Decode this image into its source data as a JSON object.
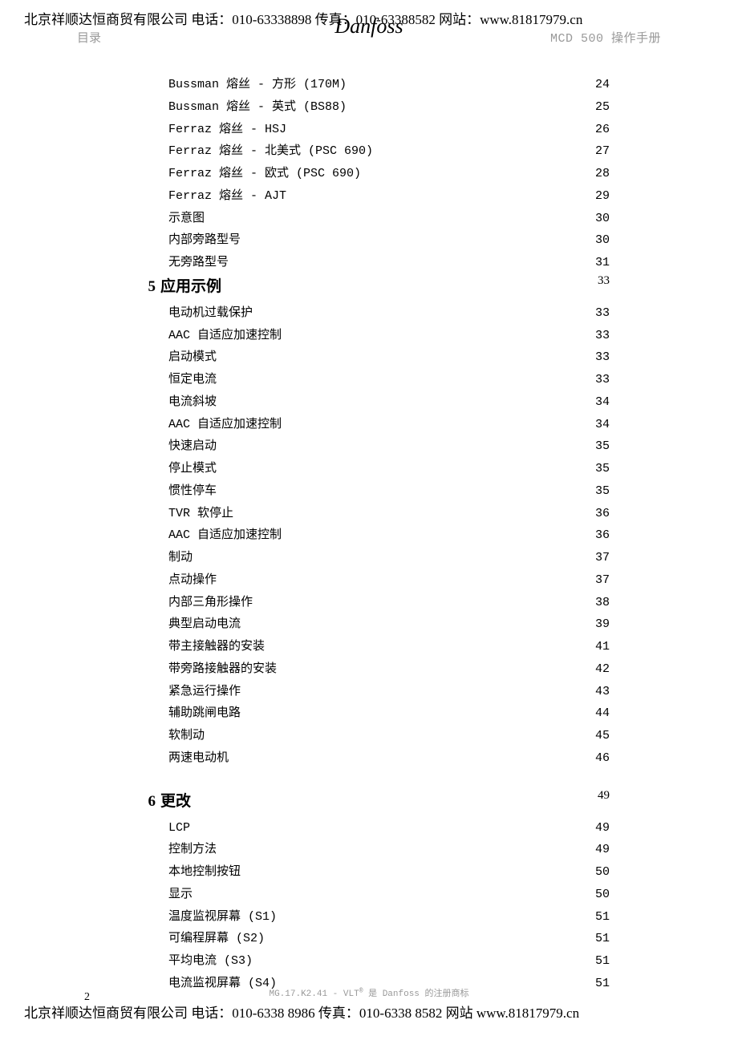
{
  "topHeader": "北京祥顺达恒商贸有限公司 电话：010-63338898 传真：010-63388582 网站：www.81817979.cn",
  "headerLeft": "目录",
  "logo": "Danfoss",
  "headerRight": "MCD 500 操作手册",
  "initialEntries": [
    {
      "title": "Bussman 熔丝 - 方形 (170M)",
      "page": "24"
    },
    {
      "title": "Bussman 熔丝 - 英式 (BS88)",
      "page": "25"
    },
    {
      "title": "Ferraz 熔丝 - HSJ",
      "page": "26"
    },
    {
      "title": "Ferraz 熔丝 - 北美式 (PSC 690)",
      "page": "27"
    },
    {
      "title": "Ferraz 熔丝 - 欧式 (PSC 690)",
      "page": "28"
    },
    {
      "title": "Ferraz 熔丝 - AJT",
      "page": "29"
    },
    {
      "title": "示意图",
      "page": "30"
    },
    {
      "title": "内部旁路型号",
      "page": "30"
    },
    {
      "title": "无旁路型号",
      "page": "31"
    }
  ],
  "sections": [
    {
      "num": "5",
      "title": "应用示例",
      "page": "33",
      "entries": [
        {
          "title": "电动机过载保护",
          "page": "33"
        },
        {
          "title": "AAC 自适应加速控制",
          "page": "33"
        },
        {
          "title": "启动模式",
          "page": "33"
        },
        {
          "title": "恒定电流",
          "page": "33"
        },
        {
          "title": "电流斜坡",
          "page": "34"
        },
        {
          "title": "AAC 自适应加速控制",
          "page": "34"
        },
        {
          "title": "快速启动",
          "page": "35"
        },
        {
          "title": "停止模式",
          "page": "35"
        },
        {
          "title": "惯性停车",
          "page": "35"
        },
        {
          "title": "TVR 软停止",
          "page": "36"
        },
        {
          "title": "AAC 自适应加速控制",
          "page": "36"
        },
        {
          "title": "制动",
          "page": "37"
        },
        {
          "title": "点动操作",
          "page": "37"
        },
        {
          "title": "内部三角形操作",
          "page": "38"
        },
        {
          "title": "典型启动电流",
          "page": "39"
        },
        {
          "title": "带主接触器的安装",
          "page": "41"
        },
        {
          "title": "带旁路接触器的安装",
          "page": "42"
        },
        {
          "title": "紧急运行操作",
          "page": "43"
        },
        {
          "title": "辅助跳闸电路",
          "page": "44"
        },
        {
          "title": "软制动",
          "page": "45"
        },
        {
          "title": "两速电动机",
          "page": "46"
        }
      ]
    },
    {
      "num": "6",
      "title": "更改",
      "page": "49",
      "entries": [
        {
          "title": "LCP",
          "page": "49"
        },
        {
          "title": "控制方法",
          "page": "49"
        },
        {
          "title": "本地控制按钮",
          "page": "50"
        },
        {
          "title": "显示",
          "page": "50"
        },
        {
          "title": "温度监视屏幕 (S1)",
          "page": "51"
        },
        {
          "title": "可编程屏幕 (S2)",
          "page": "51"
        },
        {
          "title": "平均电流 (S3)",
          "page": "51"
        },
        {
          "title": "电流监视屏幕 (S4)",
          "page": "51"
        }
      ]
    }
  ],
  "footerNotePre": "MG.17.K2.41 - VLT",
  "footerNotePost": " 是 Danfoss 的注册商标",
  "pageNum": "2",
  "bottomFooter": "北京祥顺达恒商贸有限公司 电话：010-6338 8986 传真：010-6338 8582 网站 www.81817979.cn"
}
